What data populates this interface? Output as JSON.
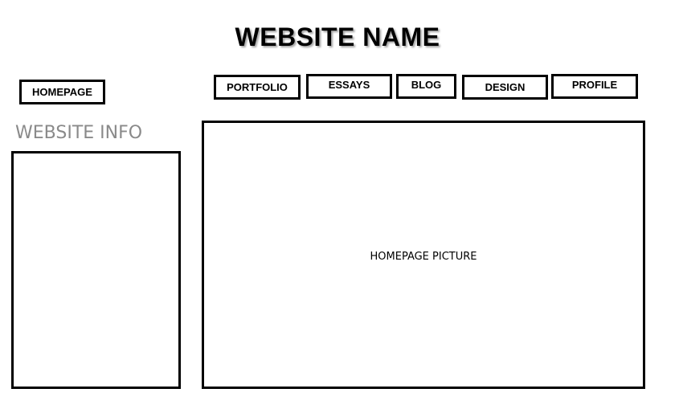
{
  "header": {
    "site_name": "WEBSITE NAME"
  },
  "nav": {
    "homepage": "HOMEPAGE",
    "portfolio": "PORTFOLIO",
    "essays": "ESSAYS",
    "blog": "BLOG",
    "design": "DESIGN",
    "profile": "PROFILE"
  },
  "sidebar": {
    "heading": "WEBSITE INFO"
  },
  "main": {
    "picture_label": "HOMEPAGE PICTURE"
  },
  "colors": {
    "border": "#000000",
    "heading_gray": "#8a8a8a",
    "background": "#ffffff"
  }
}
